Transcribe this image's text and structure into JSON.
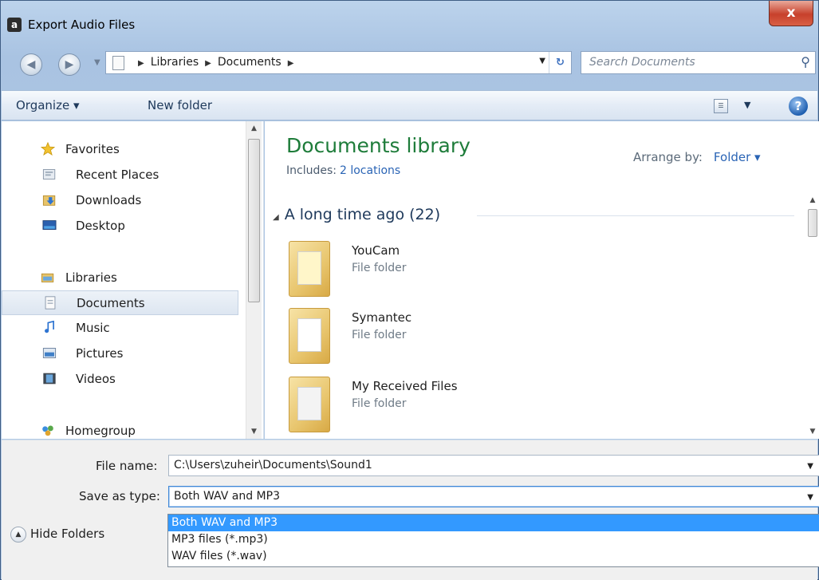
{
  "window": {
    "title": "Export Audio Files",
    "close_glyph": "x"
  },
  "address": {
    "crumbs": [
      "Libraries",
      "Documents"
    ],
    "search_placeholder": "Search Documents"
  },
  "toolbar": {
    "organize": "Organize ▾",
    "new_folder": "New folder"
  },
  "nav": {
    "favorites": "Favorites",
    "recent_places": "Recent Places",
    "downloads": "Downloads",
    "desktop": "Desktop",
    "libraries": "Libraries",
    "documents": "Documents",
    "music": "Music",
    "pictures": "Pictures",
    "videos": "Videos",
    "homegroup": "Homegroup"
  },
  "content": {
    "library_title": "Documents library",
    "includes_label": "Includes:",
    "includes_link": "2 locations",
    "arrange_label": "Arrange by:",
    "arrange_value": "Folder ▾",
    "group_header": "A long time ago (22)",
    "files": [
      {
        "name": "YouCam",
        "type": "File folder"
      },
      {
        "name": "Symantec",
        "type": "File folder"
      },
      {
        "name": "My Received Files",
        "type": "File folder"
      }
    ]
  },
  "form": {
    "file_name_label": "File name:",
    "file_name_value": "C:\\Users\\zuheir\\Documents\\Sound1",
    "save_type_label": "Save as type:",
    "save_type_value": "Both WAV and MP3",
    "options": [
      "Both WAV and MP3",
      "MP3 files (*.mp3)",
      "WAV files (*.wav)"
    ],
    "hide_folders": "Hide Folders"
  },
  "colors": {
    "selection": "#3399ff",
    "library_title": "#1e7c3a",
    "link": "#2a64b5"
  }
}
